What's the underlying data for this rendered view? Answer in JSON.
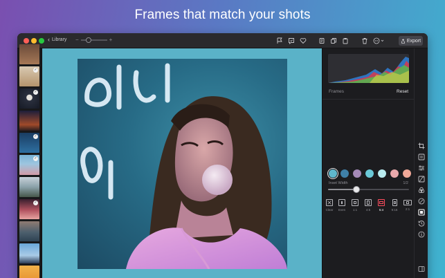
{
  "headline": "Frames that match your shots",
  "window": {
    "back_label": "Library",
    "zoom_minus": "−",
    "zoom_plus": "+",
    "export_label": "Export"
  },
  "toolbar_icons": [
    "flag-icon",
    "compare-icon",
    "heart-icon",
    "copy-icon",
    "duplicate-icon",
    "paste-icon",
    "trash-icon",
    "more-icon"
  ],
  "filmstrip": {
    "thumbnails": [
      {
        "name": "beach-cliff",
        "checked": false
      },
      {
        "name": "sand-dunes",
        "checked": true
      },
      {
        "name": "moon-night",
        "checked": true
      },
      {
        "name": "person-sunset",
        "checked": false
      },
      {
        "name": "neon-portrait",
        "checked": false
      },
      {
        "name": "blue-lake",
        "checked": true
      },
      {
        "name": "woman-sky",
        "checked": true
      },
      {
        "name": "mountain-snow",
        "checked": false
      },
      {
        "name": "bubblegum-portrait",
        "checked": true
      },
      {
        "name": "mountain-lake",
        "checked": false
      },
      {
        "name": "man-sky",
        "checked": false
      },
      {
        "name": "desert",
        "checked": false
      }
    ]
  },
  "inspector": {
    "section_title": "Frames",
    "reset_label": "Reset",
    "swatch_colors": [
      "#5fb7cc",
      "#3f80a8",
      "#a58ab8",
      "#6bc9d8",
      "#b9ecf0",
      "#e9a9ac",
      "#f0a898"
    ],
    "selected_swatch": 0,
    "inset_label": "Inset Width",
    "inset_value": "1/2",
    "inset_fraction": 0.35,
    "ratios": [
      "Clear",
      "Even",
      "1:1",
      "4:5",
      "5:4",
      "9:16",
      "2:1"
    ],
    "selected_ratio": 4
  },
  "tools": [
    "crop-icon",
    "adjust-icon",
    "sliders-icon",
    "curves-icon",
    "color-mix-icon",
    "effects-icon",
    "frames-icon",
    "history-icon",
    "info-icon"
  ],
  "active_tool": 6
}
